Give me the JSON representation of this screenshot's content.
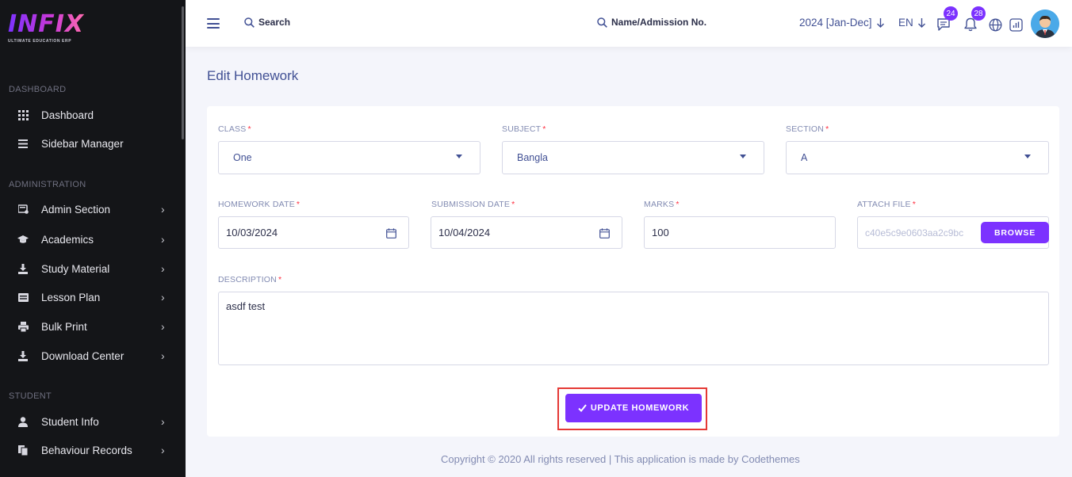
{
  "logo": {
    "main": "INFIX",
    "sub": "ULTIMATE EDUCATION ERP"
  },
  "sidebar": {
    "sections": {
      "dashboard": "DASHBOARD",
      "administration": "ADMINISTRATION",
      "student": "STUDENT"
    },
    "items": [
      {
        "label": "Dashboard",
        "icon": "grid-icon",
        "has_submenu": false
      },
      {
        "label": "Sidebar Manager",
        "icon": "bars-icon",
        "has_submenu": false
      },
      {
        "label": "Admin Section",
        "icon": "admin-icon",
        "has_submenu": true
      },
      {
        "label": "Academics",
        "icon": "graduation-cap-icon",
        "has_submenu": true
      },
      {
        "label": "Study Material",
        "icon": "download-icon",
        "has_submenu": true
      },
      {
        "label": "Lesson Plan",
        "icon": "list-icon",
        "has_submenu": true
      },
      {
        "label": "Bulk Print",
        "icon": "print-icon",
        "has_submenu": true
      },
      {
        "label": "Download Center",
        "icon": "download-icon",
        "has_submenu": true
      },
      {
        "label": "Student Info",
        "icon": "user-icon",
        "has_submenu": true
      },
      {
        "label": "Behaviour Records",
        "icon": "records-icon",
        "has_submenu": true
      }
    ],
    "chevron": "›"
  },
  "header": {
    "search_label": "Search",
    "name_search_label": "Name/Admission No.",
    "year": "2024 [Jan-Dec]",
    "language": "EN",
    "messages_count": "24",
    "notifications_count": "28"
  },
  "page": {
    "title": "Edit Homework"
  },
  "form": {
    "class": {
      "label": "CLASS",
      "value": "One"
    },
    "subject": {
      "label": "SUBJECT",
      "value": "Bangla"
    },
    "section": {
      "label": "SECTION",
      "value": "A"
    },
    "homework_date": {
      "label": "HOMEWORK DATE",
      "value": "10/03/2024"
    },
    "submission_date": {
      "label": "SUBMISSION DATE",
      "value": "10/04/2024"
    },
    "marks": {
      "label": "MARKS",
      "value": "100"
    },
    "attach_file": {
      "label": "ATTACH FILE",
      "value": "c40e5c9e0603aa2c9bc",
      "browse_label": "BROWSE"
    },
    "description": {
      "label": "DESCRIPTION",
      "value": "asdf test"
    },
    "required_mark": "*",
    "submit_label": "UPDATE HOMEWORK"
  },
  "footer": {
    "text": "Copyright © 2020 All rights reserved | This application is made by Codethemes"
  },
  "colors": {
    "accent": "#7c32ff",
    "sidebar_bg": "#141518",
    "text_primary": "#415094",
    "highlight": "#e53935"
  }
}
